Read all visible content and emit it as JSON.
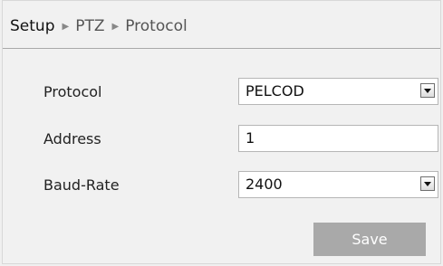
{
  "breadcrumb": {
    "items": [
      "Setup",
      "PTZ",
      "Protocol"
    ],
    "separator": "▶"
  },
  "form": {
    "protocol": {
      "label": "Protocol",
      "value": "PELCOD"
    },
    "address": {
      "label": "Address",
      "value": "1"
    },
    "baud_rate": {
      "label": "Baud-Rate",
      "value": "2400"
    }
  },
  "actions": {
    "save_label": "Save"
  }
}
